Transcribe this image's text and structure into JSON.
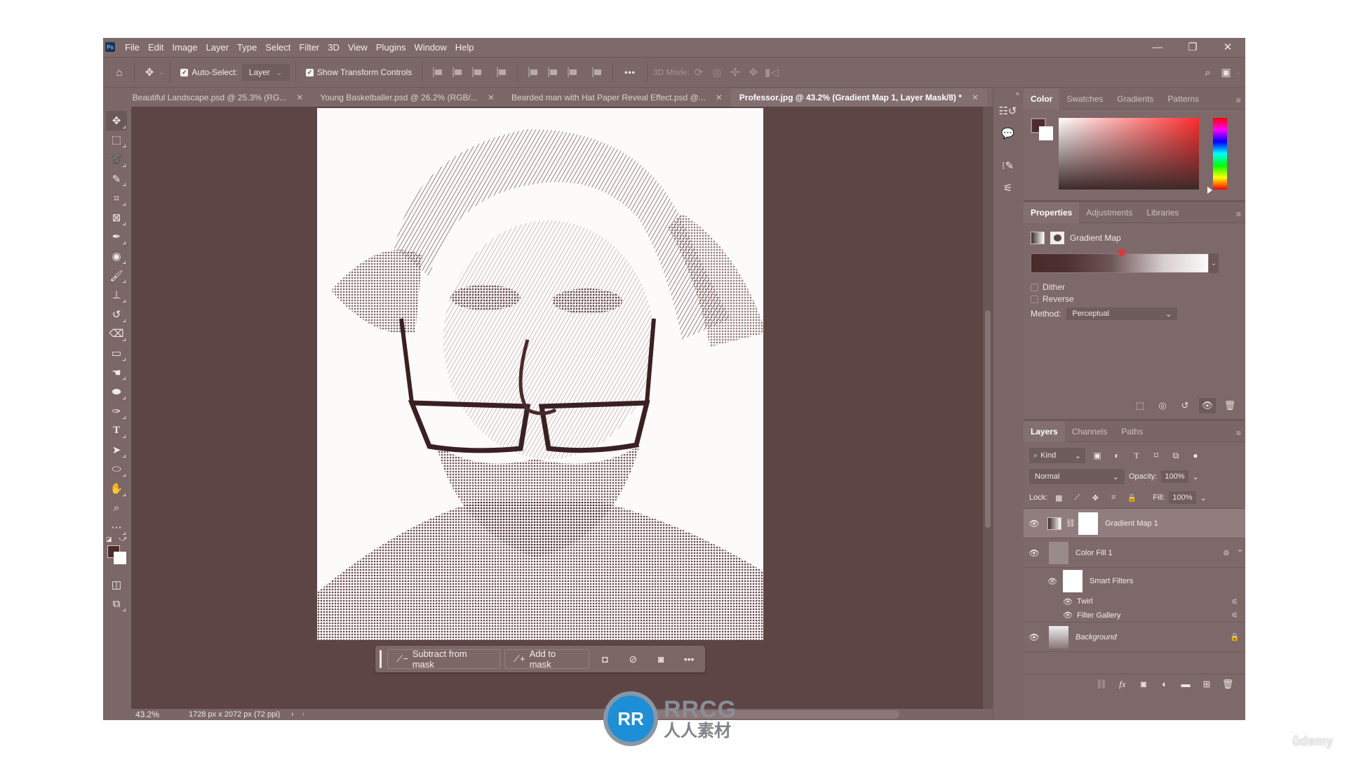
{
  "app": {
    "logo": "Ps",
    "menu": [
      "File",
      "Edit",
      "Image",
      "Layer",
      "Type",
      "Select",
      "Filter",
      "3D",
      "View",
      "Plugins",
      "Window",
      "Help"
    ],
    "window_controls": {
      "minimize": "—",
      "restore": "❐",
      "close": "✕"
    }
  },
  "options_bar": {
    "auto_select_label": "Auto-Select:",
    "auto_select_checked": true,
    "auto_select_value": "Layer",
    "show_transform_label": "Show Transform Controls",
    "show_transform_checked": true,
    "more": "•••",
    "mode_3d_label": "3D Mode:"
  },
  "tabs": [
    {
      "label": "Beautiful Landscape.psd @ 25.3% (RG...",
      "active": false
    },
    {
      "label": "Young Basketballer.psd @ 26.2% (RGB/...",
      "active": false
    },
    {
      "label": "Bearded man with Hat Paper Reveal Effect.psd @...",
      "active": false
    },
    {
      "label": "Professor.jpg @ 43.2% (Gradient Map 1, Layer Mask/8) *",
      "active": true
    }
  ],
  "tools": [
    "move-tool",
    "marquee-tool",
    "lasso-tool",
    "quick-selection-tool",
    "crop-tool",
    "frame-tool",
    "eyedropper-tool",
    "healing-tool",
    "brush-tool",
    "stamp-tool",
    "history-brush-tool",
    "eraser-tool",
    "gradient-tool",
    "smudge-tool",
    "sponge-tool",
    "pen-tool",
    "type-tool",
    "path-selection-tool",
    "ellipse-tool",
    "hand-tool",
    "zoom-tool",
    "more-tools"
  ],
  "colors": {
    "foreground": "#4b2a2c",
    "background": "#ffffff",
    "canvas_bg": "#5d4546",
    "ui_bg": "#7d6868"
  },
  "task_bar": {
    "subtract": "Subtract from mask",
    "add": "Add to mask",
    "more": "•••"
  },
  "status": {
    "zoom": "43.2%",
    "doc_info": "1728 px x 2072 px (72 ppi)"
  },
  "color_panel": {
    "tabs": [
      "Color",
      "Swatches",
      "Gradients",
      "Patterns"
    ],
    "active_tab": "Color"
  },
  "properties_panel": {
    "tabs": [
      "Properties",
      "Adjustments",
      "Libraries"
    ],
    "active_tab": "Properties",
    "title": "Gradient Map",
    "dither_label": "Dither",
    "dither_checked": false,
    "reverse_label": "Reverse",
    "reverse_checked": false,
    "method_label": "Method:",
    "method_value": "Perceptual",
    "gradient_start": "#4a2b2d",
    "gradient_end": "#fcfafa"
  },
  "layers_panel": {
    "tabs": [
      "Layers",
      "Channels",
      "Paths"
    ],
    "active_tab": "Layers",
    "filter_kind": "Kind",
    "blend_mode": "Normal",
    "opacity_label": "Opacity:",
    "opacity": "100%",
    "lock_label": "Lock:",
    "fill_label": "Fill:",
    "fill": "100%",
    "layers": [
      {
        "name": "Gradient Map 1",
        "visible": true,
        "selected": true,
        "type": "adjustment"
      },
      {
        "name": "Color Fill 1",
        "visible": true,
        "selected": false,
        "type": "smart-object"
      },
      {
        "name": "Background",
        "visible": true,
        "selected": false,
        "type": "background",
        "locked": true
      }
    ],
    "smart_filters": {
      "label": "Smart Filters",
      "filters": [
        "Twirl",
        "Filter Gallery"
      ]
    }
  },
  "watermarks": {
    "rrcg_en": "RRCG",
    "rrcg_cn": "人人素材",
    "udemy": "ûdemy"
  }
}
